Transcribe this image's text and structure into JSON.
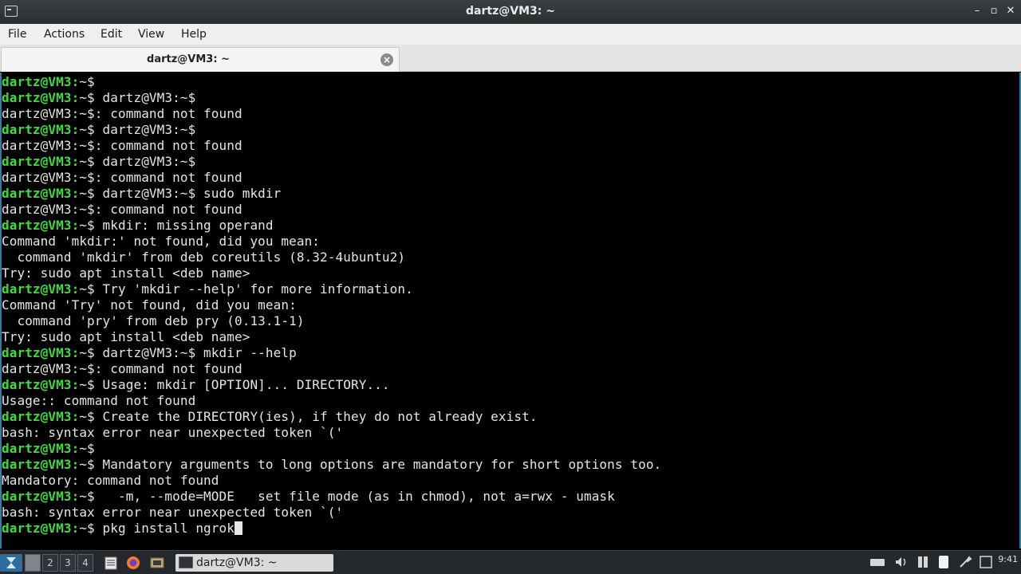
{
  "window": {
    "title": "dartz@VM3: ~"
  },
  "menu": {
    "items": [
      "File",
      "Actions",
      "Edit",
      "View",
      "Help"
    ]
  },
  "tab": {
    "label": "dartz@VM3: ~"
  },
  "terminal": {
    "prompt": "dartz@VM3:",
    "lines": [
      {
        "p": true,
        "text": "~$"
      },
      {
        "p": true,
        "text": "~$ dartz@VM3:~$"
      },
      {
        "p": false,
        "text": "dartz@VM3:~$: command not found"
      },
      {
        "p": true,
        "text": "~$ dartz@VM3:~$"
      },
      {
        "p": false,
        "text": "dartz@VM3:~$: command not found"
      },
      {
        "p": true,
        "text": "~$ dartz@VM3:~$"
      },
      {
        "p": false,
        "text": "dartz@VM3:~$: command not found"
      },
      {
        "p": true,
        "text": "~$ dartz@VM3:~$ sudo mkdir"
      },
      {
        "p": false,
        "text": "dartz@VM3:~$: command not found"
      },
      {
        "p": true,
        "text": "~$ mkdir: missing operand"
      },
      {
        "p": false,
        "text": "Command 'mkdir:' not found, did you mean:"
      },
      {
        "p": false,
        "text": "  command 'mkdir' from deb coreutils (8.32-4ubuntu2)"
      },
      {
        "p": false,
        "text": "Try: sudo apt install <deb name>"
      },
      {
        "p": true,
        "text": "~$ Try 'mkdir --help' for more information."
      },
      {
        "p": false,
        "text": "Command 'Try' not found, did you mean:"
      },
      {
        "p": false,
        "text": "  command 'pry' from deb pry (0.13.1-1)"
      },
      {
        "p": false,
        "text": "Try: sudo apt install <deb name>"
      },
      {
        "p": true,
        "text": "~$ dartz@VM3:~$ mkdir --help"
      },
      {
        "p": false,
        "text": "dartz@VM3:~$: command not found"
      },
      {
        "p": true,
        "text": "~$ Usage: mkdir [OPTION]... DIRECTORY..."
      },
      {
        "p": false,
        "text": "Usage:: command not found"
      },
      {
        "p": true,
        "text": "~$ Create the DIRECTORY(ies), if they do not already exist."
      },
      {
        "p": false,
        "text": "bash: syntax error near unexpected token `('"
      },
      {
        "p": true,
        "text": "~$"
      },
      {
        "p": true,
        "text": "~$ Mandatory arguments to long options are mandatory for short options too."
      },
      {
        "p": false,
        "text": "Mandatory: command not found"
      },
      {
        "p": true,
        "text": "~$   -m, --mode=MODE   set file mode (as in chmod), not a=rwx - umask"
      },
      {
        "p": false,
        "text": "bash: syntax error near unexpected token `('"
      },
      {
        "p": true,
        "text": "~$ pkg install ngrok",
        "cursor": true
      }
    ]
  },
  "taskbar": {
    "desktops": [
      "",
      "2",
      "3",
      "4"
    ],
    "active_desktop": 0,
    "launchers": [
      "file-manager-icon",
      "firefox-icon",
      "terminal-launcher-icon"
    ],
    "task_label": "dartz@VM3: ~",
    "tray_icons": [
      "keyboard-icon",
      "volume-icon",
      "network-icon",
      "clipboard-icon",
      "settings-icon",
      "power-icon"
    ],
    "clock": "9:41"
  }
}
